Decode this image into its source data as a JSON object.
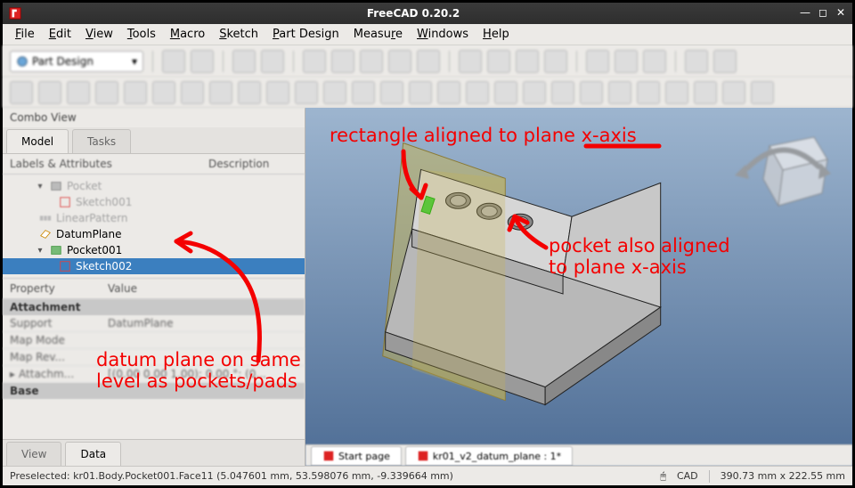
{
  "titlebar": {
    "title": "FreeCAD 0.20.2"
  },
  "menu": {
    "file": "File",
    "edit": "Edit",
    "view": "View",
    "tools": "Tools",
    "macro": "Macro",
    "sketch": "Sketch",
    "partdesign": "Part Design",
    "measure": "Measure",
    "windows": "Windows",
    "help": "Help"
  },
  "toolbar": {
    "workbench": "Part Design"
  },
  "combo_view": {
    "title": "Combo View",
    "tabs": {
      "model": "Model",
      "tasks": "Tasks"
    },
    "tree_header": {
      "labels": "Labels & Attributes",
      "desc": "Description"
    },
    "tree": {
      "pocket": "Pocket",
      "sketch001": "Sketch001",
      "linearpattern": "LinearPattern",
      "datumplane": "DatumPlane",
      "pocket001": "Pocket001",
      "sketch002": "Sketch002"
    },
    "prop_header": {
      "property": "Property",
      "value": "Value"
    },
    "sections": {
      "attachment": "Attachment",
      "base": "Base"
    },
    "props": {
      "support_k": "Support",
      "support_v": "DatumPlane",
      "mapmode_k": "Map Mode",
      "mapmode_v": "",
      "maprev_k": "Map Rev...",
      "maprev_v": "",
      "attach_k": "Attachm...",
      "attach_v": "[(0.00 0.00 1.00); 0.00 °; (0..."
    },
    "bottom_tabs": {
      "view": "View",
      "data": "Data"
    }
  },
  "doctabs": {
    "start": "Start page",
    "model": "kr01_v2_datum_plane : 1*"
  },
  "status": {
    "left": "Preselected: kr01.Body.Pocket001.Face11 (5.047601 mm, 53.598076 mm, -9.339664 mm)",
    "cad": "CAD",
    "dims": "390.73 mm x 222.55 mm"
  },
  "annotations": {
    "a1": "rectangle aligned to plane x-axis",
    "a2": "pocket also aligned\nto plane x-axis",
    "a3": "datum plane on same\nlevel as pockets/pads"
  },
  "colors": {
    "anno": "#f40000",
    "selection": "#3b7fbf"
  }
}
